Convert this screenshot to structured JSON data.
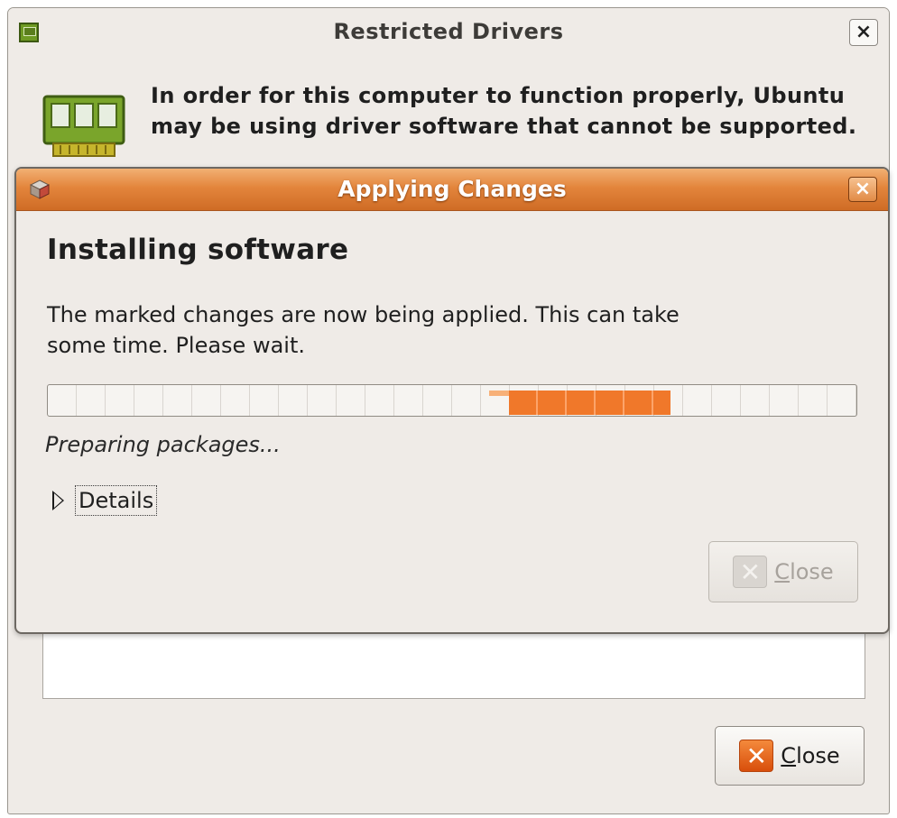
{
  "back_window": {
    "title": "Restricted Drivers",
    "close_glyph": "×",
    "message": "In order for this computer to function properly, Ubuntu may be using driver software that cannot be supported.",
    "close_button": {
      "label": "Close",
      "icon": "x-icon"
    }
  },
  "dialog": {
    "title": "Applying Changes",
    "close_glyph": "×",
    "heading": "Installing software",
    "description": "The marked changes are now being applied. This can take some time. Please wait.",
    "progress": {
      "mode": "pulse",
      "pulse_start": 0.57,
      "pulse_end": 0.77,
      "color": "#f0782a"
    },
    "status": "Preparing packages...",
    "details_label": "Details",
    "close_button": {
      "label": "Close",
      "icon": "x-icon",
      "enabled": false
    }
  },
  "colors": {
    "titlebar_accent": "#e3853c",
    "window_bg": "#efebe7"
  }
}
